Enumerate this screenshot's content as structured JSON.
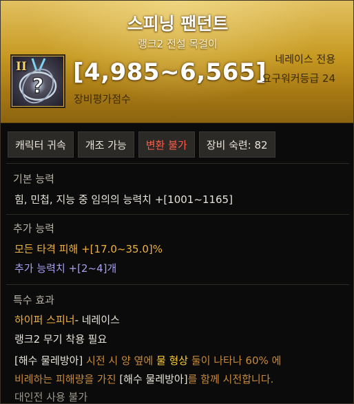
{
  "item": {
    "name": "스피닝 팬던트",
    "type": "랭크2 전설 목걸이",
    "rank_badge": "II",
    "score": "[4,985~6,565]",
    "score_label": "장비평가점수",
    "class": "네레이스 전용",
    "req_level": "요구워커등급 24"
  },
  "tags": [
    {
      "label": "캐릭터 귀속"
    },
    {
      "label": "개조 가능"
    },
    {
      "label": "변환 불가"
    },
    {
      "label": "장비 숙련: 82"
    }
  ],
  "basic": {
    "title": "기본 능력",
    "line": "힘, 민첩, 지능 중 임의의 능력치 +[1001~1165]"
  },
  "extra": {
    "title": "추가 능력",
    "line1": "모든 타격 피해  +[17.0~35.0]%",
    "line2": "추가 능력치 +[2~4]개"
  },
  "special": {
    "title": "특수 효과",
    "skill_name": "하이퍼 스피너",
    "skill_class": "- 네레이스",
    "requirement": "랭크2 무기 착용 필요",
    "desc_p1": "[해수 물레방아]",
    "desc_p2": " 시전 시 양 옆에 ",
    "desc_p3": "물 형상",
    "desc_p4": " 둘이 나타나 60% 에",
    "desc_p5": "비례하는 피해량을 가진 ",
    "desc_p6": "[해수 물레방아]",
    "desc_p7": "를 함께 시전합니다.",
    "pvp": "대인전 사용 불가"
  },
  "colors": {
    "header_gold": "#c79a22",
    "red_tag": "#ff5c4a",
    "orange": "#f0b23e",
    "blue": "#a8a0f0"
  },
  "icons": {
    "item_icon": "pendant-icon"
  }
}
